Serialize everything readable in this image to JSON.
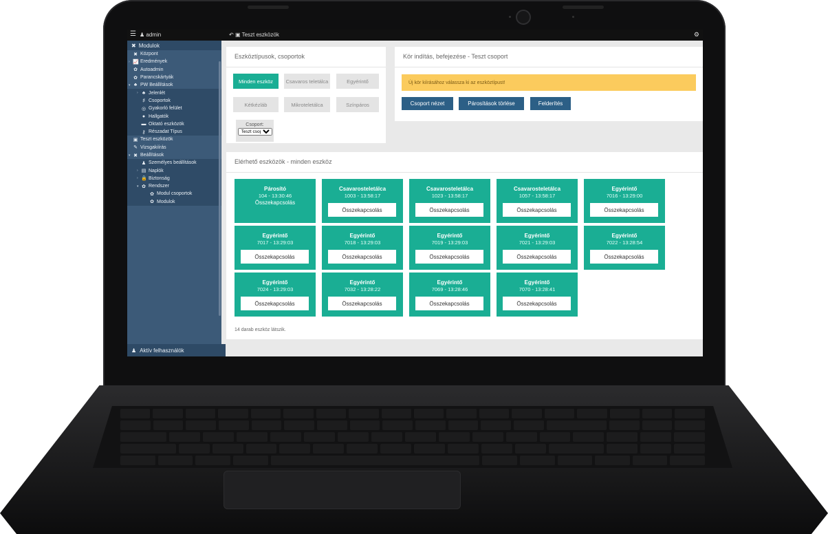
{
  "topbar": {
    "username": "admin",
    "breadcrumb": "Teszt eszközök"
  },
  "sidebar": {
    "header": "Modulok",
    "items": [
      {
        "label": "Központ",
        "icon": "modules-icon",
        "arrow": ""
      },
      {
        "label": "Eredmények",
        "icon": "chart-icon",
        "arrow": "›"
      },
      {
        "label": "Autoadmin",
        "icon": "gear-icon",
        "arrow": ""
      },
      {
        "label": "Parancskártyák",
        "icon": "gear-icon",
        "arrow": ""
      },
      {
        "label": "PW Beállítások",
        "icon": "users-icon",
        "arrow": "▾"
      },
      {
        "label": "Jelenlét",
        "icon": "users-icon",
        "arrow": "›"
      },
      {
        "label": "Csoportok",
        "icon": "group-icon",
        "arrow": ""
      },
      {
        "label": "Gyakorló felület",
        "icon": "globe-icon",
        "arrow": ""
      },
      {
        "label": "Hallgatók",
        "icon": "student-icon",
        "arrow": ""
      },
      {
        "label": "Oktató eszközök",
        "icon": "monitor-icon",
        "arrow": ""
      },
      {
        "label": "Részadat Típus",
        "icon": "key-icon",
        "arrow": ""
      },
      {
        "label": "Teszt eszközök",
        "icon": "device-icon",
        "arrow": ""
      },
      {
        "label": "Vizsgakiírás",
        "icon": "exam-icon",
        "arrow": ""
      },
      {
        "label": "Beállítások",
        "icon": "tools-icon",
        "arrow": "▾"
      },
      {
        "label": "Személyes beállítások",
        "icon": "user-icon",
        "arrow": ""
      },
      {
        "label": "Naplók",
        "icon": "log-icon",
        "arrow": "›"
      },
      {
        "label": "Biztonság",
        "icon": "lock-icon",
        "arrow": "›"
      },
      {
        "label": "Rendszer",
        "icon": "gear-icon",
        "arrow": "▾"
      },
      {
        "label": "Modul csoportok",
        "icon": "gear-icon",
        "arrow": ""
      },
      {
        "label": "Modulok",
        "icon": "gear-icon",
        "arrow": ""
      }
    ],
    "footer": "Aktív felhasználók"
  },
  "types_panel": {
    "title": "Eszköztípusok, csoportok",
    "buttons": [
      "Minden eszköz",
      "Csavaros teletálca",
      "Egyérintő",
      "Kétkézláb",
      "Mikroteletálca",
      "Színpáros"
    ],
    "group_label": "Csoport:",
    "group_value": "Teszt csoport"
  },
  "round_panel": {
    "title": "Kör indítás, befejezése - Teszt csoport",
    "alert": "Új kör kiírásához válassza ki az eszköztípust!",
    "buttons": [
      "Csoport nézet",
      "Párosítások törlése",
      "Felderítés"
    ],
    "button_color": "#2c5f86",
    "alert_color": "#fbcb5d"
  },
  "devices_panel": {
    "title": "Elérhető eszközök - minden eszköz",
    "accent": "#1aae94",
    "connect_label": "Összekapcsolás",
    "devices": [
      {
        "name": "Párosító",
        "time": "104 - 13:30:46",
        "button": false
      },
      {
        "name": "Csavarosteletálca",
        "time": "1003 - 13:58:17",
        "button": true
      },
      {
        "name": "Csavarosteletálca",
        "time": "1023 - 13:58:17",
        "button": true
      },
      {
        "name": "Csavarosteletálca",
        "time": "1057 - 13:58:17",
        "button": true
      },
      {
        "name": "Egyérintő",
        "time": "7016 - 13:29:00",
        "button": true
      },
      {
        "name": "Egyérintő",
        "time": "7017 - 13:29:03",
        "button": true
      },
      {
        "name": "Egyérintő",
        "time": "7018 - 13:29:03",
        "button": true
      },
      {
        "name": "Egyérintő",
        "time": "7019 - 13:29:03",
        "button": true
      },
      {
        "name": "Egyérintő",
        "time": "7021 - 13:29:03",
        "button": true
      },
      {
        "name": "Egyérintő",
        "time": "7022 - 13:28:54",
        "button": true
      },
      {
        "name": "Egyérintő",
        "time": "7024 - 13:29:03",
        "button": true
      },
      {
        "name": "Egyérintő",
        "time": "7032 - 13:28:22",
        "button": true
      },
      {
        "name": "Egyérintő",
        "time": "7069 - 13:28:46",
        "button": true
      },
      {
        "name": "Egyérintő",
        "time": "7070 - 13:28:41",
        "button": true
      }
    ],
    "count_text": "14 darab eszköz látszik."
  }
}
